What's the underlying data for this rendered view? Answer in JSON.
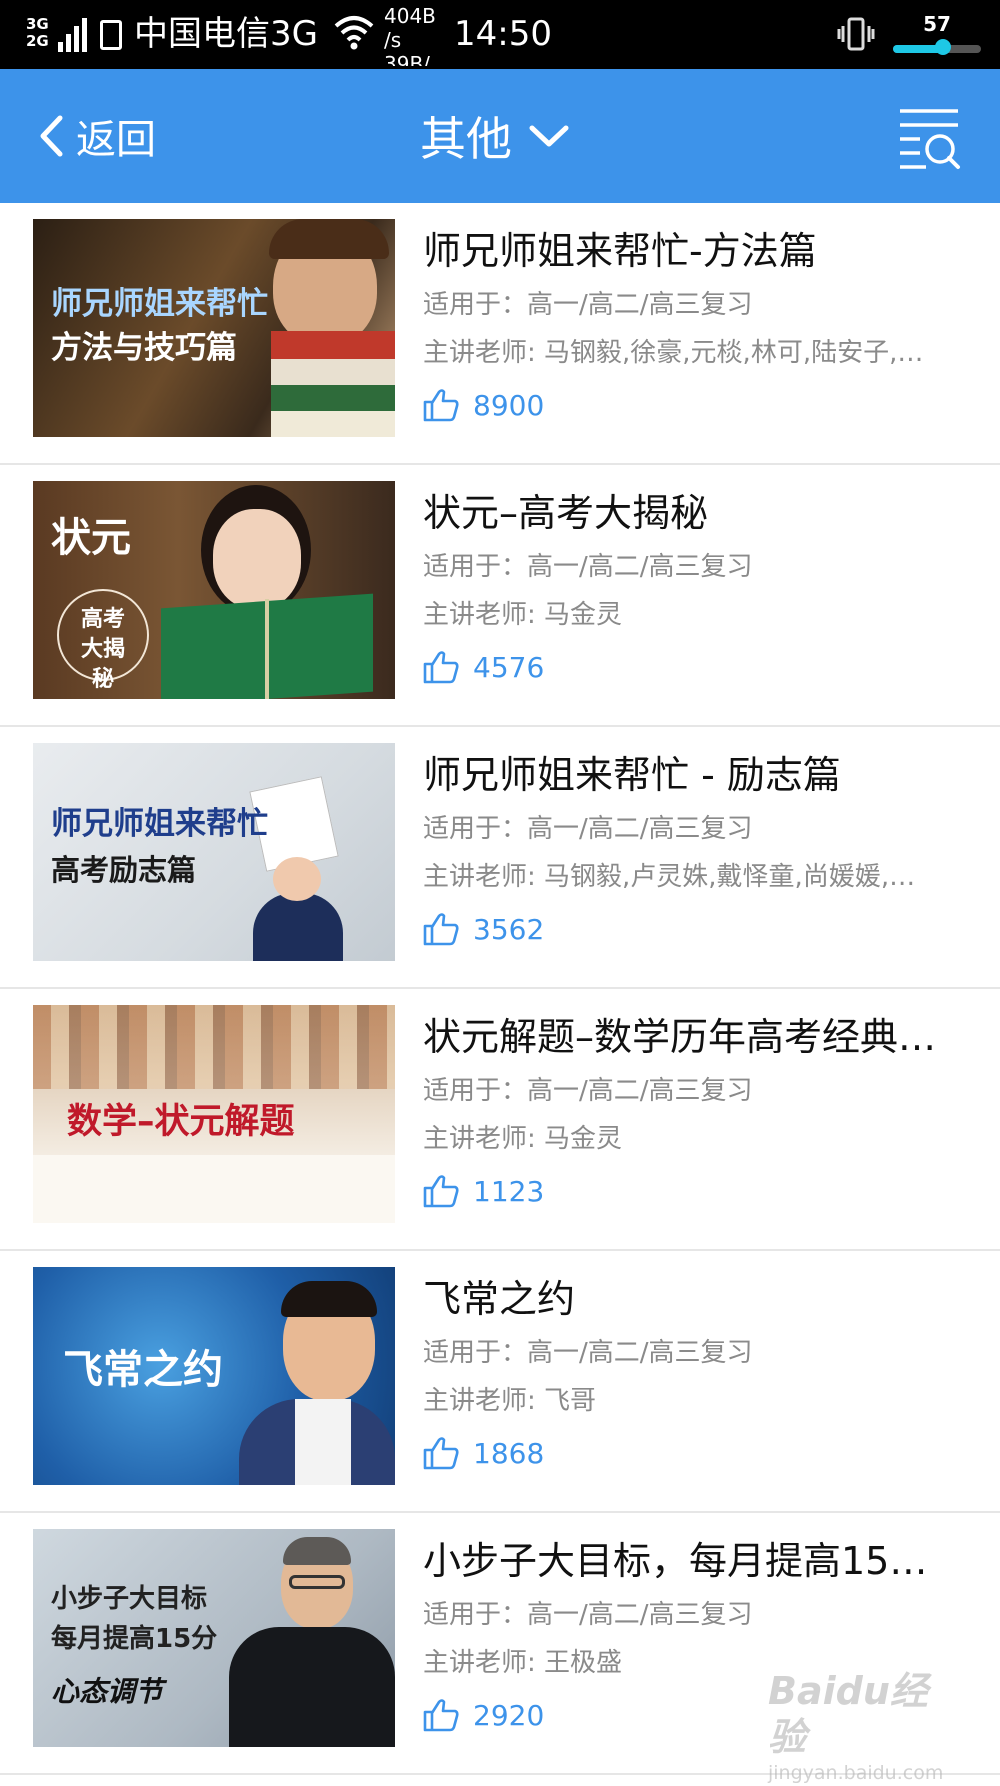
{
  "status_bar": {
    "network": "3G\n2G",
    "carrier": "中国电信3G",
    "speed": "404B /s 39B/",
    "time": "14:50",
    "battery": "57",
    "battery_level": 0.57
  },
  "nav": {
    "back_label": "返回",
    "title": "其他"
  },
  "colors": {
    "brand": "#3d93ea",
    "title_text": "#111111",
    "meta_text": "#8a8a8a",
    "divider": "#e6e6e6"
  },
  "courses": [
    {
      "title": "师兄师姐来帮忙-方法篇",
      "applies": "适用于：高一/高二/高三复习",
      "teachers": "主讲老师: 马钢毅,徐豪,元棪,林可,陆安子,…",
      "likes": "8900",
      "thumb_line1": "师兄师姐来帮忙",
      "thumb_line2": "方法与技巧篇"
    },
    {
      "title": "状元–高考大揭秘",
      "applies": "适用于：高一/高二/高三复习",
      "teachers": "主讲老师: 马金灵",
      "likes": "4576",
      "thumb_line1": "状元",
      "thumb_line2": "高考 大揭秘"
    },
    {
      "title": "师兄师姐来帮忙 - 励志篇",
      "applies": "适用于：高一/高二/高三复习",
      "teachers": "主讲老师: 马钢毅,卢灵姝,戴怿童,尚媛媛,…",
      "likes": "3562",
      "thumb_line1": "师兄师姐来帮忙",
      "thumb_line2": "高考励志篇"
    },
    {
      "title": "状元解题–数学历年高考经典…",
      "applies": "适用于：高一/高二/高三复习",
      "teachers": "主讲老师: 马金灵",
      "likes": "1123",
      "thumb_line1": "数学–状元解题",
      "thumb_line2": ""
    },
    {
      "title": "飞常之约",
      "applies": "适用于：高一/高二/高三复习",
      "teachers": "主讲老师: 飞哥",
      "likes": "1868",
      "thumb_line1": "飞常之约",
      "thumb_line2": ""
    },
    {
      "title": "小步子大目标，每月提高15…",
      "applies": "适用于：高一/高二/高三复习",
      "teachers": "主讲老师: 王极盛",
      "likes": "2920",
      "thumb_line1": "小步子大目标",
      "thumb_line2": "每月提高15分",
      "thumb_line3": "心态调节"
    }
  ],
  "watermark": {
    "logo": "Baidu经验",
    "url": "jingyan.baidu.com"
  }
}
